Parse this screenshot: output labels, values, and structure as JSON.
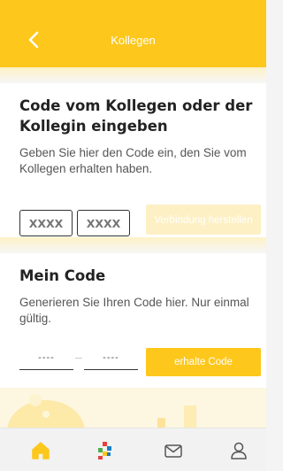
{
  "header": {
    "title": "Kollegen",
    "back_icon": "chevron-left-icon",
    "background": "#fdc71c"
  },
  "colleague_code": {
    "title": "Code vom Kollegen oder der Kollegin eingeben",
    "description": "Geben Sie hier den Code ein, den Sie vom Kollegen erhalten haben.",
    "field1_placeholder": "XXXX",
    "field2_placeholder": "XXXX",
    "connect_button": "Verbindung herstellen",
    "connect_button_state": "disabled"
  },
  "my_code": {
    "title": "Mein Code",
    "description": "Generieren Sie Ihren Code hier. Nur einmal gültig.",
    "field1_value": "----",
    "field2_value": "----",
    "generate_button": "erhalte Code"
  },
  "bottom_nav": {
    "items": [
      {
        "icon": "home-icon",
        "active": true
      },
      {
        "icon": "grid-logo-icon",
        "active": false
      },
      {
        "icon": "mail-icon",
        "active": false
      },
      {
        "icon": "profile-icon",
        "active": false
      }
    ]
  },
  "colors": {
    "accent": "#fdc71c",
    "accent_disabled": "#fdf0c4",
    "text": "#222222"
  }
}
